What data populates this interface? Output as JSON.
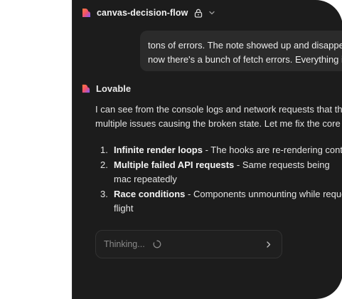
{
  "header": {
    "project_name": "canvas-decision-flow",
    "logo_icon": "lovable-heart-icon",
    "lock_icon": "lock-icon",
    "menu_icon": "chevron-down-icon"
  },
  "user_message": {
    "lines": [
      "tons of errors. The note showed up and disappea",
      "now there's a bunch of fetch errors. Everything is"
    ]
  },
  "assistant": {
    "name": "Lovable",
    "intro_lines": [
      "I can see from the console logs and network requests that th",
      "multiple issues causing the broken state. Let me fix the core p"
    ],
    "issues": [
      {
        "number": "1.",
        "title": "Infinite render loops",
        "text": " - The hooks are re-rendering contir"
      },
      {
        "number": "2.",
        "title": "Multiple failed API requests",
        "text": " - Same requests being mac repeatedly"
      },
      {
        "number": "3.",
        "title": "Race conditions",
        "text": " - Components unmounting while reque flight"
      }
    ]
  },
  "status": {
    "label": "Thinking...",
    "spinner_icon": "spinner-icon",
    "arrow_icon": "chevron-right-icon"
  },
  "colors": {
    "panel_bg": "#1c1c1c",
    "bubble_bg": "#2b2b2b",
    "text": "#e4e4e4",
    "muted": "#8a8a8a",
    "logo_gradient_start": "#f0506e",
    "logo_gradient_end": "#7b5cff"
  }
}
